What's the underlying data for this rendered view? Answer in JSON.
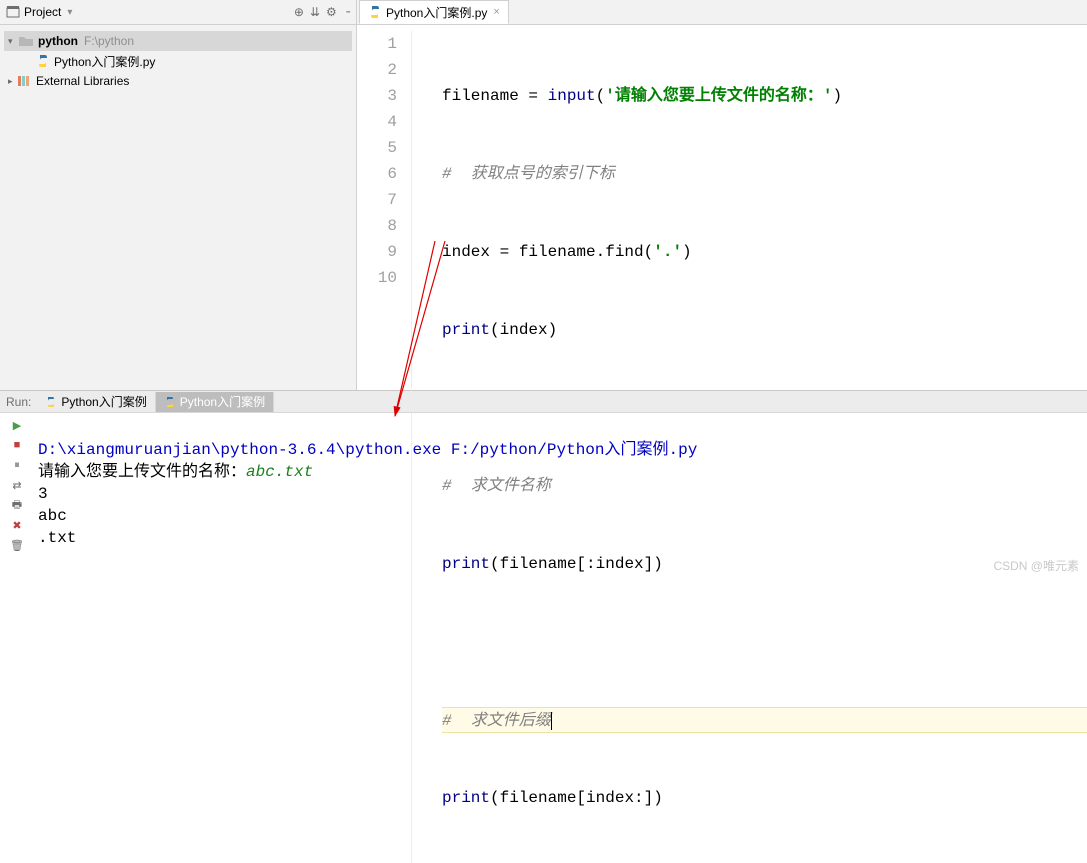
{
  "sidebar": {
    "title": "Project",
    "root": {
      "name": "python",
      "path": "F:\\python"
    },
    "file": "Python入门案例.py",
    "ext_lib": "External Libraries"
  },
  "tab": {
    "filename": "Python入门案例.py"
  },
  "code": {
    "l1a": "filename = ",
    "l1fn": "input",
    "l1p": "(",
    "l1s": "'请输入您要上传文件的名称：'",
    "l1e": ")",
    "l2": "#  获取点号的索引下标",
    "l3a": "index = filename.find(",
    "l3s": "'.'",
    "l3e": ")",
    "l4fn": "print",
    "l4b": "(index)",
    "l6": "#  求文件名称",
    "l7fn": "print",
    "l7b": "(filename[:index])",
    "l9": "#  求文件后缀",
    "l10fn": "print",
    "l10b": "(filename[index:])"
  },
  "gutter": [
    "1",
    "2",
    "3",
    "4",
    "5",
    "6",
    "7",
    "8",
    "9",
    "10"
  ],
  "run": {
    "label": "Run:",
    "tab1": "Python入门案例",
    "tab2": "Python入门案例"
  },
  "console": {
    "path": "D:\\xiangmuruanjian\\python-3.6.4\\python.exe F:/python/Python入门案例.py",
    "prompt": "请输入您要上传文件的名称：",
    "user_input": "abc.txt",
    "out1": "3",
    "out2": "abc",
    "out3": ".txt"
  },
  "watermark": "CSDN @唯元素"
}
